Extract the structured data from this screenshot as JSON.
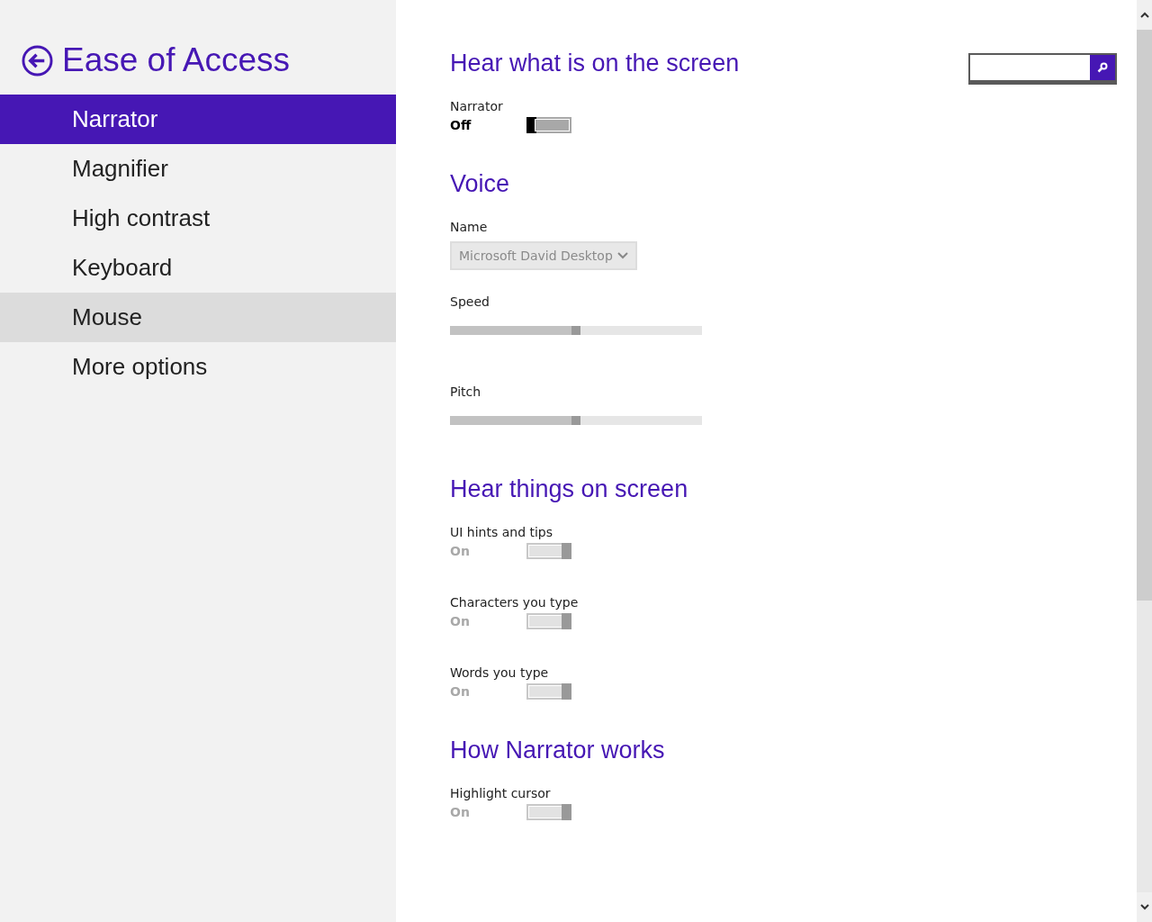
{
  "sidebar": {
    "title": "Ease of Access",
    "items": [
      {
        "label": "Narrator",
        "selected": true,
        "hovered": false
      },
      {
        "label": "Magnifier",
        "selected": false,
        "hovered": false
      },
      {
        "label": "High contrast",
        "selected": false,
        "hovered": false
      },
      {
        "label": "Keyboard",
        "selected": false,
        "hovered": false
      },
      {
        "label": "Mouse",
        "selected": false,
        "hovered": true
      },
      {
        "label": "More options",
        "selected": false,
        "hovered": false
      }
    ]
  },
  "sections": [
    {
      "heading": "Hear what is on the screen",
      "controls": [
        {
          "kind": "toggle",
          "label": "Narrator",
          "state": "Off",
          "on": false,
          "disabled": false
        }
      ]
    },
    {
      "heading": "Voice",
      "controls": [
        {
          "kind": "dropdown",
          "label": "Name",
          "value": "Microsoft David Desktop",
          "disabled": true
        },
        {
          "kind": "slider",
          "label": "Speed",
          "level": 0.5,
          "disabled": true
        },
        {
          "kind": "slider",
          "label": "Pitch",
          "level": 0.5,
          "disabled": true
        }
      ]
    },
    {
      "heading": "Hear things on screen",
      "controls": [
        {
          "kind": "toggle",
          "label": "UI hints and tips",
          "state": "On",
          "on": true,
          "disabled": true
        },
        {
          "kind": "toggle",
          "label": "Characters you type",
          "state": "On",
          "on": true,
          "disabled": true
        },
        {
          "kind": "toggle",
          "label": "Words you type",
          "state": "On",
          "on": true,
          "disabled": true
        }
      ]
    },
    {
      "heading": "How Narrator works",
      "controls": [
        {
          "kind": "toggle",
          "label": "Highlight cursor",
          "state": "On",
          "on": true,
          "disabled": true
        }
      ]
    }
  ]
}
